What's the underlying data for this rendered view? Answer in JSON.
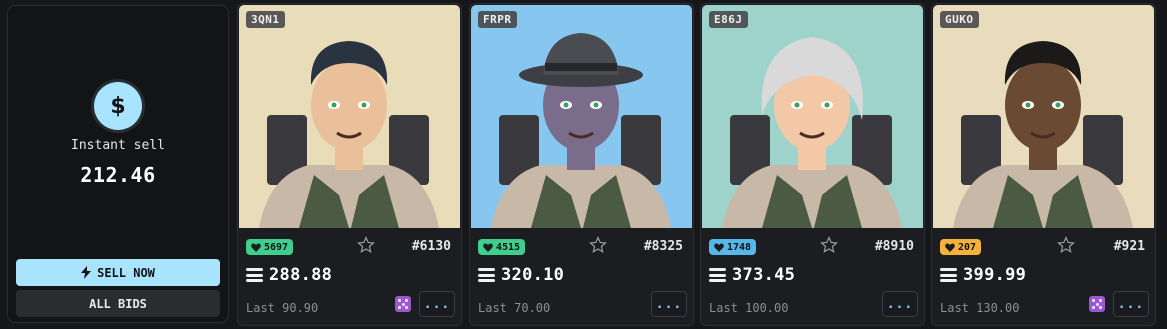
{
  "instant_sell": {
    "icon": "dollar-icon",
    "dollar_symbol": "$",
    "label": "Instant sell",
    "value": "212.46",
    "sell_now_label": "SELL NOW",
    "all_bids_label": "ALL BIDS",
    "accent_color": "#a9e4ff"
  },
  "cards": [
    {
      "code": "3QN1",
      "likes": "5697",
      "likes_color": "#3ecf8e",
      "number": "#6130",
      "price": "288.88",
      "last": "Last 90.90",
      "has_dice": true,
      "dots_label": "...",
      "art_bg": "#e8dcb9"
    },
    {
      "code": "FRPR",
      "likes": "4515",
      "likes_color": "#3ecf8e",
      "number": "#8325",
      "price": "320.10",
      "last": "Last 70.00",
      "has_dice": false,
      "dots_label": "...",
      "art_bg": "#86c6ef"
    },
    {
      "code": "E86J",
      "likes": "1748",
      "likes_color": "#56b8ea",
      "number": "#8910",
      "price": "373.45",
      "last": "Last 100.00",
      "has_dice": false,
      "dots_label": "...",
      "art_bg": "#9ed3cc"
    },
    {
      "code": "GUKO",
      "likes": "207",
      "likes_color": "#f5b13a",
      "number": "#921",
      "price": "399.99",
      "last": "Last 130.00",
      "has_dice": true,
      "dots_label": "...",
      "art_bg": "#e9dcbd"
    }
  ]
}
